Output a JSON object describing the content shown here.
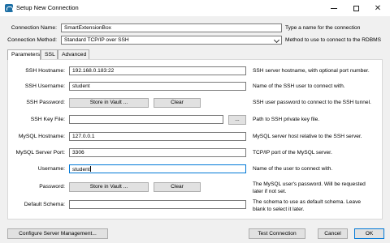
{
  "window": {
    "title": "Setup New Connection"
  },
  "connection": {
    "name_label": "Connection Name:",
    "name_value": "SmartExtensionBox",
    "name_hint": "Type a name for the connection",
    "method_label": "Connection Method:",
    "method_value": "Standard TCP/IP over SSH",
    "method_hint": "Method to use to connect to the RDBMS"
  },
  "tabs": [
    {
      "label": "Parameters"
    },
    {
      "label": "SSL"
    },
    {
      "label": "Advanced"
    }
  ],
  "params": {
    "ssh_hostname_label": "SSH Hostname:",
    "ssh_hostname_value": "192.168.0.183:22",
    "ssh_hostname_desc": "SSH server hostname, with  optional port number.",
    "ssh_username_label": "SSH Username:",
    "ssh_username_value": "student",
    "ssh_username_desc": "Name of the SSH user to connect with.",
    "ssh_password_label": "SSH Password:",
    "ssh_password_desc": "SSH user password to connect to the SSH tunnel.",
    "ssh_keyfile_label": "SSH Key File:",
    "ssh_keyfile_value": "",
    "ssh_keyfile_browse": "...",
    "ssh_keyfile_desc": "Path to SSH private key file.",
    "mysql_hostname_label": "MySQL Hostname:",
    "mysql_hostname_value": "127.0.0.1",
    "mysql_hostname_desc": "MySQL server host relative to the SSH server.",
    "mysql_port_label": "MySQL Server Port:",
    "mysql_port_value": "3306",
    "mysql_port_desc": "TCP/IP port of the MySQL server.",
    "username_label": "Username:",
    "username_value": "student",
    "username_desc": "Name of the user to connect with.",
    "password_label": "Password:",
    "password_desc_line1": "The MySQL user's password. Will be requested",
    "password_desc_line2": "later if not set.",
    "schema_label": "Default Schema:",
    "schema_value": "",
    "schema_desc_line1": "The schema to use as default schema. Leave",
    "schema_desc_line2": "blank to select it later.",
    "store_vault_label": "Store in Vault ...",
    "clear_label": "Clear"
  },
  "footer": {
    "configure_label": "Configure Server Management...",
    "test_label": "Test Connection",
    "cancel_label": "Cancel",
    "ok_label": "OK"
  }
}
